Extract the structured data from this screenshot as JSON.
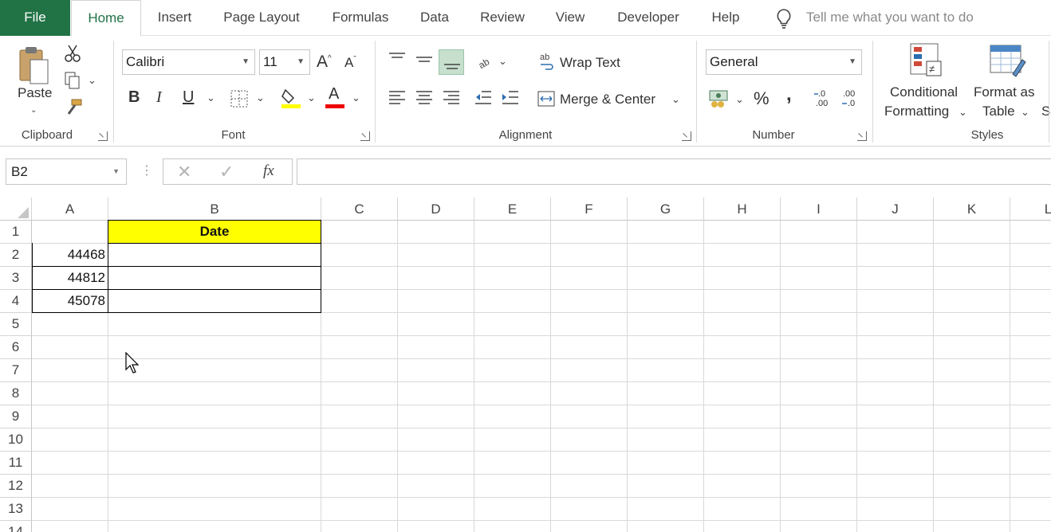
{
  "tabs": [
    "File",
    "Home",
    "Insert",
    "Page Layout",
    "Formulas",
    "Data",
    "Review",
    "View",
    "Developer",
    "Help"
  ],
  "tell_me": "Tell me what you want to do",
  "clipboard": {
    "paste_label": "Paste",
    "group_label": "Clipboard"
  },
  "font": {
    "name": "Calibri",
    "size": "11",
    "bold": "B",
    "italic": "I",
    "underline": "U",
    "group_label": "Font",
    "fill_color": "#ffff00",
    "font_color": "#ff0000"
  },
  "alignment": {
    "wrap_text": "Wrap Text",
    "merge_center": "Merge & Center",
    "group_label": "Alignment"
  },
  "number": {
    "format": "General",
    "percent": "%",
    "comma": ",",
    "inc_decimal": "←.0\n.00",
    "dec_decimal": ".00\n→.0",
    "group_label": "Number"
  },
  "styles": {
    "conditional_line1": "Conditional",
    "conditional_line2": "Formatting",
    "format_table_line1": "Format as",
    "format_table_line2": "Table",
    "group_label": "Styles",
    "cell_styles_partial": "S"
  },
  "formula_bar": {
    "name_box": "B2",
    "fx": "fx",
    "content": ""
  },
  "columns": [
    "A",
    "B",
    "C",
    "D",
    "E",
    "F",
    "G",
    "H",
    "I",
    "J",
    "K",
    "L"
  ],
  "rows": [
    "1",
    "2",
    "3",
    "4",
    "5",
    "6",
    "7",
    "8",
    "9",
    "10",
    "11",
    "12",
    "13",
    "14"
  ],
  "cells": {
    "B1": "Date",
    "A2": "44468",
    "A3": "44812",
    "A4": "45078"
  },
  "colors": {
    "accent": "#217346",
    "header_fill": "#ffff00"
  }
}
